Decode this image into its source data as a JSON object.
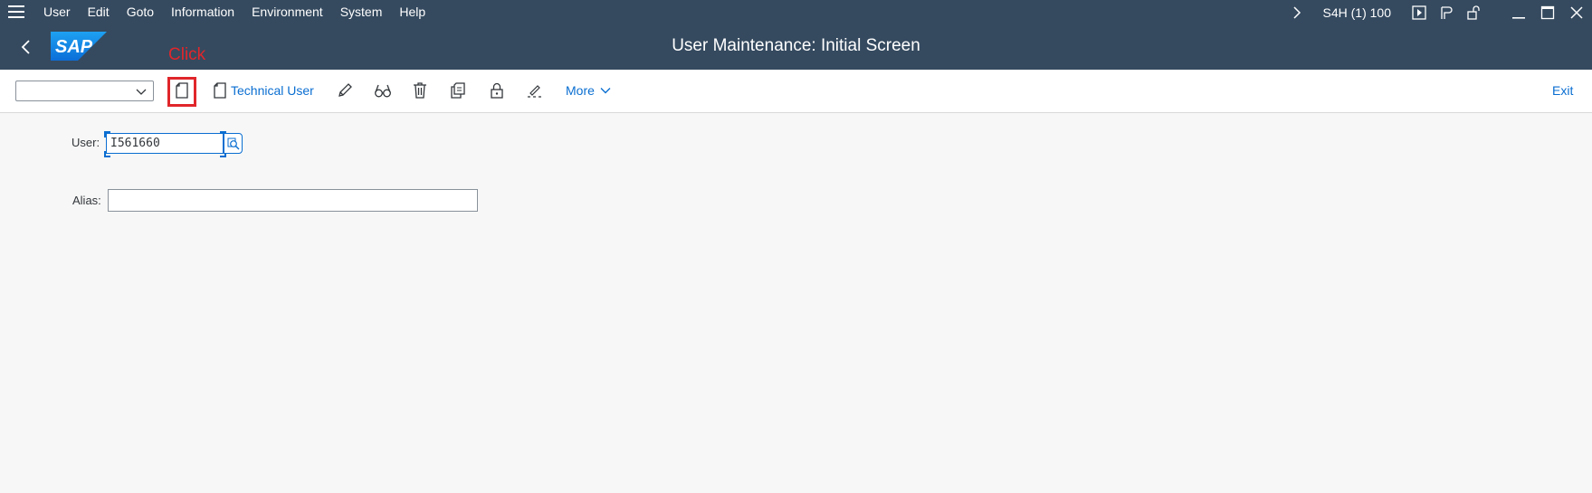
{
  "menubar": {
    "items": [
      "User",
      "Edit",
      "Goto",
      "Information",
      "Environment",
      "System",
      "Help"
    ],
    "system_info": "S4H (1) 100"
  },
  "header": {
    "title": "User Maintenance: Initial Screen",
    "logo_text": "SAP"
  },
  "annotation": {
    "hint_text": "Click"
  },
  "toolbar": {
    "combo_value": "",
    "technical_user_label": "Technical User",
    "more_label": "More",
    "exit_label": "Exit"
  },
  "form": {
    "user_label": "User:",
    "user_value": "I561660",
    "alias_label": "Alias:",
    "alias_value": ""
  },
  "colors": {
    "shell_bg": "#354a5f",
    "accent": "#0a6ed1",
    "highlight": "#e0262b",
    "page_bg": "#f7f7f7"
  }
}
